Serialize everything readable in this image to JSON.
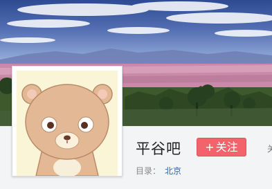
{
  "forum": {
    "name": "平谷吧",
    "follow_label": "关注",
    "follow_prefix": "+",
    "category_label": "目录：",
    "category_value": "北京",
    "edge_text": "关"
  },
  "colors": {
    "follow_button": "#f2636c",
    "category_link": "#2d64b3",
    "avatar_background": "#fbf5d8",
    "bear_fur": "#e2b895"
  },
  "icons": {
    "avatar": "bear-avatar-icon",
    "banner": "landscape-banner-image"
  }
}
